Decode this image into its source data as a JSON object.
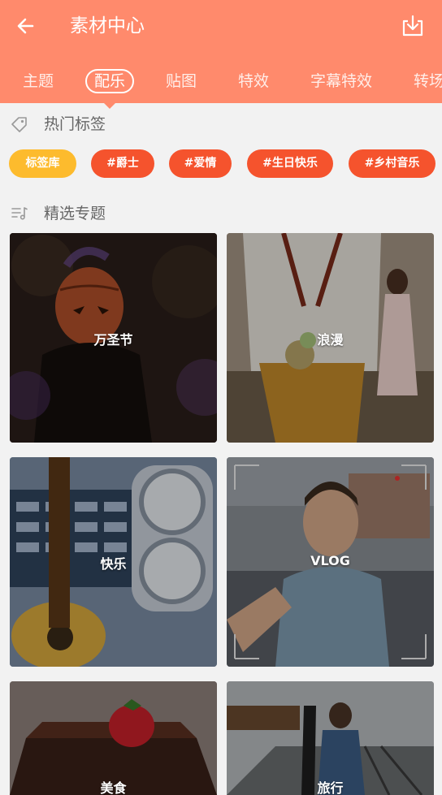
{
  "header": {
    "title": "素材中心",
    "background": "#ff8a6c"
  },
  "tabs": [
    {
      "label": "主题",
      "active": false
    },
    {
      "label": "配乐",
      "active": true
    },
    {
      "label": "贴图",
      "active": false
    },
    {
      "label": "特效",
      "active": false
    },
    {
      "label": "字幕特效",
      "active": false
    },
    {
      "label": "转场",
      "active": false
    }
  ],
  "hot_tags": {
    "heading": "热门标签",
    "icon": "tag-icon",
    "chips": [
      {
        "label": "标签库",
        "color": "#fdbb2d"
      },
      {
        "label": "#爵士",
        "color": "#f5532d"
      },
      {
        "label": "#爱情",
        "color": "#f5532d"
      },
      {
        "label": "#生日快乐",
        "color": "#f5532d"
      },
      {
        "label": "#乡村音乐",
        "color": "#f5532d"
      }
    ]
  },
  "featured": {
    "heading": "精选专题",
    "icon": "music-list-icon",
    "cards": [
      {
        "label": "万圣节"
      },
      {
        "label": "浪漫"
      },
      {
        "label": "快乐"
      },
      {
        "label": "VLOG"
      },
      {
        "label": "美食"
      },
      {
        "label": "旅行"
      }
    ]
  }
}
